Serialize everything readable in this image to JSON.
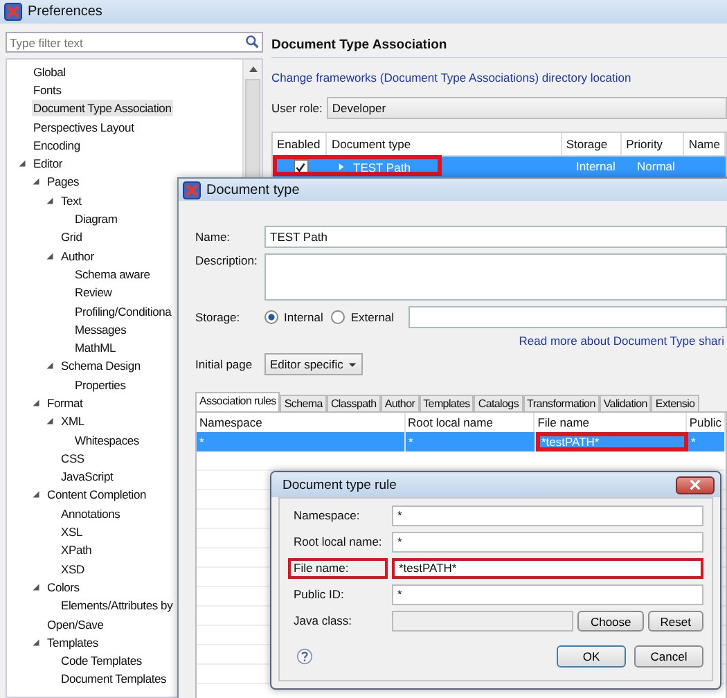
{
  "window": {
    "title": "Preferences"
  },
  "sidebar": {
    "filter_placeholder": "Type filter text",
    "items": [
      {
        "label": "Global",
        "selected": false
      },
      {
        "label": "Fonts",
        "selected": false
      },
      {
        "label": "Document Type Association",
        "selected": true
      },
      {
        "label": "Perspectives Layout",
        "selected": false
      },
      {
        "label": "Encoding",
        "selected": false
      },
      {
        "label": "Editor",
        "selected": false,
        "expanded": true,
        "children": [
          {
            "label": "Pages",
            "selected": false,
            "expanded": true,
            "children": [
              {
                "label": "Text",
                "selected": false,
                "expanded": true,
                "children": [
                  {
                    "label": "Diagram",
                    "selected": false
                  }
                ]
              },
              {
                "label": "Grid",
                "selected": false
              },
              {
                "label": "Author",
                "selected": false,
                "expanded": true,
                "children": [
                  {
                    "label": "Schema aware",
                    "selected": false
                  },
                  {
                    "label": "Review",
                    "selected": false
                  },
                  {
                    "label": "Profiling/Conditiona",
                    "selected": false
                  },
                  {
                    "label": "Messages",
                    "selected": false
                  },
                  {
                    "label": "MathML",
                    "selected": false
                  }
                ]
              },
              {
                "label": "Schema Design",
                "selected": false,
                "expanded": true,
                "children": [
                  {
                    "label": "Properties",
                    "selected": false
                  }
                ]
              }
            ]
          },
          {
            "label": "Format",
            "selected": false,
            "expanded": true,
            "children": [
              {
                "label": "XML",
                "selected": false,
                "expanded": true,
                "children": [
                  {
                    "label": "Whitespaces",
                    "selected": false
                  }
                ]
              },
              {
                "label": "CSS",
                "selected": false
              },
              {
                "label": "JavaScript",
                "selected": false
              }
            ]
          },
          {
            "label": "Content Completion",
            "selected": false,
            "expanded": true,
            "children": [
              {
                "label": "Annotations",
                "selected": false
              },
              {
                "label": "XSL",
                "selected": false
              },
              {
                "label": "XPath",
                "selected": false
              },
              {
                "label": "XSD",
                "selected": false
              }
            ]
          },
          {
            "label": "Colors",
            "selected": false,
            "expanded": true,
            "children": [
              {
                "label": "Elements/Attributes by",
                "selected": false
              }
            ]
          },
          {
            "label": "Open/Save",
            "selected": false
          },
          {
            "label": "Templates",
            "selected": false,
            "expanded": true,
            "children": [
              {
                "label": "Code Templates",
                "selected": false
              },
              {
                "label": "Document Templates",
                "selected": false
              }
            ]
          }
        ]
      }
    ]
  },
  "page": {
    "heading": "Document Type Association",
    "link": "Change frameworks (Document Type Associations) directory location",
    "user_role_label": "User role:",
    "user_role": "Developer",
    "table": {
      "columns": [
        "Enabled",
        "Document type",
        "Storage",
        "Priority",
        "Name"
      ],
      "rows": [
        {
          "enabled": true,
          "document_type": "TEST Path",
          "storage": "Internal",
          "priority": "Normal",
          "selected": true,
          "highlighted": true
        }
      ]
    }
  },
  "document_type_dialog": {
    "title": "Document type",
    "name_label": "Name:",
    "name": "TEST Path",
    "description_label": "Description:",
    "storage_label": "Storage:",
    "storage_options": [
      {
        "label": "Internal",
        "selected": true
      },
      {
        "label": "External",
        "selected": false
      }
    ],
    "link": "Read more about Document Type shari",
    "initial_page_label": "Initial page",
    "initial_page": "Editor specific",
    "tabs": [
      {
        "label": "Association rules",
        "selected": true
      },
      {
        "label": "Schema",
        "selected": false
      },
      {
        "label": "Classpath",
        "selected": false
      },
      {
        "label": "Author",
        "selected": false
      },
      {
        "label": "Templates",
        "selected": false
      },
      {
        "label": "Catalogs",
        "selected": false
      },
      {
        "label": "Transformation",
        "selected": false
      },
      {
        "label": "Validation",
        "selected": false
      },
      {
        "label": "Extensio",
        "selected": false
      }
    ],
    "rules_table": {
      "columns": [
        "Namespace",
        "Root local name",
        "File name",
        "Public"
      ],
      "rows": [
        {
          "cells": [
            {
              "text": "*",
              "highlighted": false
            },
            {
              "text": "*",
              "highlighted": false
            },
            {
              "text": "*testPATH*",
              "highlighted": true
            },
            {
              "text": "*",
              "highlighted": false
            }
          ],
          "selected": true
        }
      ]
    }
  },
  "rule_dialog": {
    "title": "Document type rule",
    "fields": [
      {
        "label": "Namespace:",
        "value": "*",
        "highlighted": false,
        "disabled": false
      },
      {
        "label": "Root local name:",
        "value": "*",
        "highlighted": false,
        "disabled": false
      },
      {
        "label": "File name:",
        "value": "*testPATH*",
        "highlighted": true,
        "disabled": false
      },
      {
        "label": "Public ID:",
        "value": "*",
        "highlighted": false,
        "disabled": false
      },
      {
        "label": "Java class:",
        "highlighted": false,
        "disabled": true
      }
    ],
    "side_buttons": [
      "Choose",
      "Reset"
    ],
    "buttons": [
      "OK",
      "Cancel"
    ]
  }
}
